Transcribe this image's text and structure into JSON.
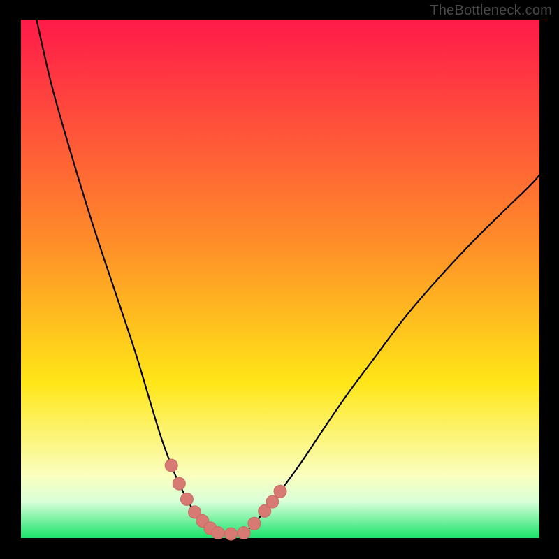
{
  "watermark": "TheBottleneck.com",
  "colors": {
    "frame": "#000000",
    "grad_top": "#ff1a4a",
    "grad_mid1": "#ff8a2a",
    "grad_mid2": "#ffe617",
    "grad_low": "#faffbf",
    "grad_bottom_band": "#d9ffd9",
    "grad_green": "#19e36a",
    "curve": "#000000",
    "marker_fill": "#d77a73",
    "marker_stroke": "#c96a63"
  },
  "chart_data": {
    "type": "line",
    "title": "",
    "xlabel": "",
    "ylabel": "",
    "xlim": [
      0,
      100
    ],
    "ylim": [
      0,
      100
    ],
    "series": [
      {
        "name": "left-curve",
        "x": [
          3,
          6,
          10,
          14,
          18,
          22,
          25,
          27,
          29,
          30.5,
          32,
          33.5,
          35,
          36.5,
          38
        ],
        "y": [
          100,
          87,
          73,
          60,
          48,
          36,
          26,
          19.5,
          14,
          10.5,
          7.5,
          5,
          3.3,
          1.9,
          1.0
        ]
      },
      {
        "name": "right-curve",
        "x": [
          43,
          45,
          47,
          50,
          54,
          58,
          63,
          68,
          74,
          80,
          86,
          92,
          98,
          100
        ],
        "y": [
          1.0,
          2.8,
          5.2,
          9.0,
          14.5,
          20.5,
          27.8,
          34.5,
          42.5,
          49.5,
          56.0,
          62.0,
          67.8,
          70.0
        ]
      },
      {
        "name": "valley-floor",
        "x": [
          38,
          40.5,
          43
        ],
        "y": [
          1.0,
          0.8,
          1.0
        ]
      }
    ],
    "markers": {
      "name": "highlight-points",
      "points": [
        {
          "x": 29.0,
          "y": 14.0
        },
        {
          "x": 30.5,
          "y": 10.5
        },
        {
          "x": 32.0,
          "y": 7.5
        },
        {
          "x": 33.5,
          "y": 5.0
        },
        {
          "x": 35.0,
          "y": 3.3
        },
        {
          "x": 36.5,
          "y": 1.9
        },
        {
          "x": 38.0,
          "y": 1.0
        },
        {
          "x": 40.5,
          "y": 0.8
        },
        {
          "x": 43.0,
          "y": 1.0
        },
        {
          "x": 45.0,
          "y": 2.8
        },
        {
          "x": 47.0,
          "y": 5.2
        },
        {
          "x": 48.5,
          "y": 7.0
        },
        {
          "x": 50.0,
          "y": 9.0
        }
      ]
    },
    "annotations": []
  }
}
